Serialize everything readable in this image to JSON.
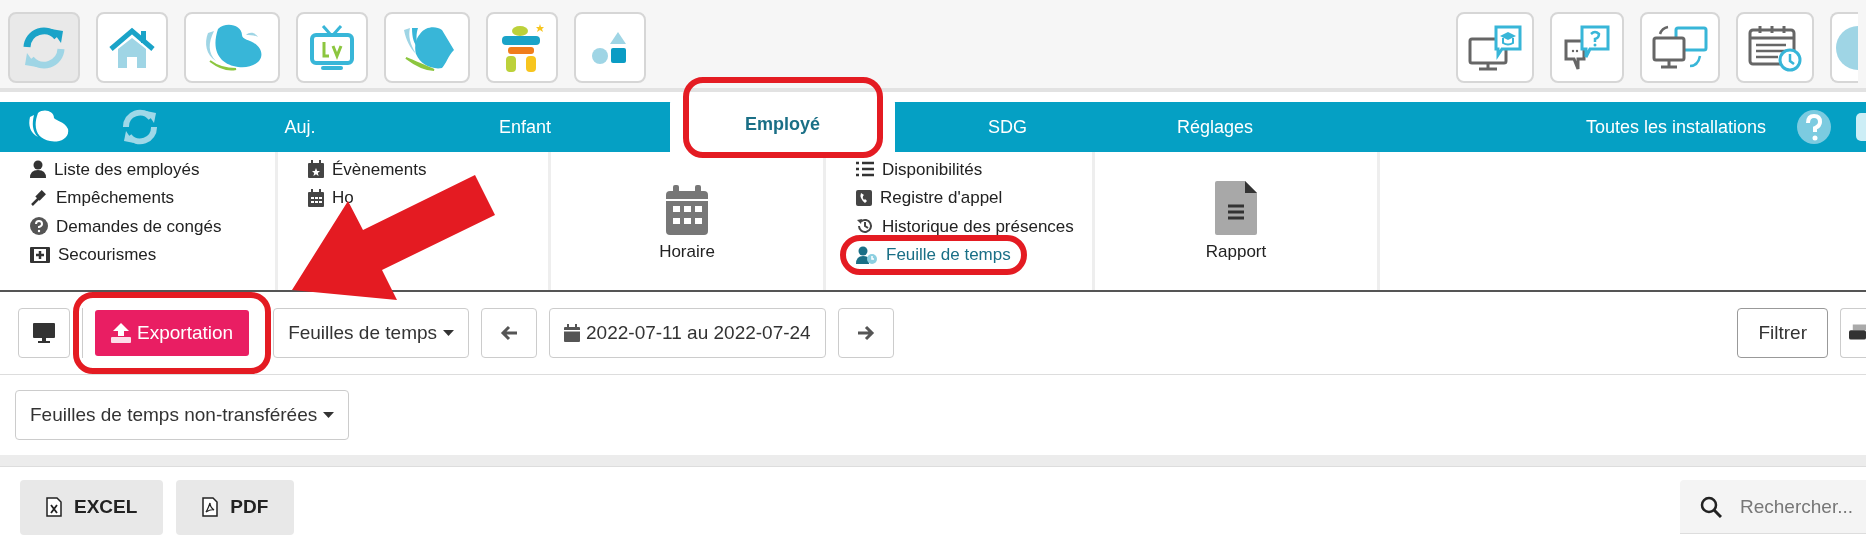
{
  "app_bar": {
    "apps": [
      {
        "selected": true
      },
      {
        "selected": false
      },
      {
        "selected": false
      },
      {
        "selected": false
      },
      {
        "selected": false
      },
      {
        "selected": false
      },
      {
        "selected": false
      }
    ]
  },
  "nav": {
    "tabs": [
      {
        "label": "Auj.",
        "selected": false,
        "highlighted": false
      },
      {
        "label": "Enfant",
        "selected": false,
        "highlighted": false
      },
      {
        "label": "Employé",
        "selected": true,
        "highlighted": true
      },
      {
        "label": "SDG",
        "selected": false,
        "highlighted": false
      },
      {
        "label": "Réglages",
        "selected": false,
        "highlighted": false
      }
    ],
    "facility": "Toutes les installations"
  },
  "submenu": {
    "columns": [
      {
        "kind": "list",
        "items": [
          {
            "label": "Liste des employés",
            "selected": false,
            "highlighted": false
          },
          {
            "label": "Empêchements",
            "selected": false,
            "highlighted": false
          },
          {
            "label": "Demandes de congés",
            "selected": false,
            "highlighted": false
          },
          {
            "label": "Secourismes",
            "selected": false,
            "highlighted": false
          }
        ]
      },
      {
        "kind": "list",
        "items": [
          {
            "label": "Évènements",
            "selected": false,
            "highlighted": false
          },
          {
            "label": "Ho",
            "selected": false,
            "highlighted": false
          }
        ]
      },
      {
        "kind": "tile",
        "label": "Horaire"
      },
      {
        "kind": "list",
        "items": [
          {
            "label": "Disponibilités",
            "selected": false,
            "highlighted": false
          },
          {
            "label": "Registre d'appel",
            "selected": false,
            "highlighted": false
          },
          {
            "label": "Historique des présences",
            "selected": false,
            "highlighted": false
          },
          {
            "label": "Feuille de temps",
            "selected": true,
            "highlighted": true
          }
        ]
      },
      {
        "kind": "tile",
        "label": "Rapport"
      }
    ]
  },
  "toolbar": {
    "export": {
      "label": "Exportation",
      "highlighted": true
    },
    "view": "Feuilles de temps",
    "date_range": "2022-07-11 au 2022-07-24",
    "filter": "Filtrer"
  },
  "status_filter": "Feuilles de temps non-transférées",
  "table_tools": {
    "buttons": [
      {
        "label": "EXCEL"
      },
      {
        "label": "PDF"
      }
    ],
    "search": {
      "placeholder": "Rechercher..."
    }
  },
  "annotation": {
    "kind": "arrow"
  }
}
